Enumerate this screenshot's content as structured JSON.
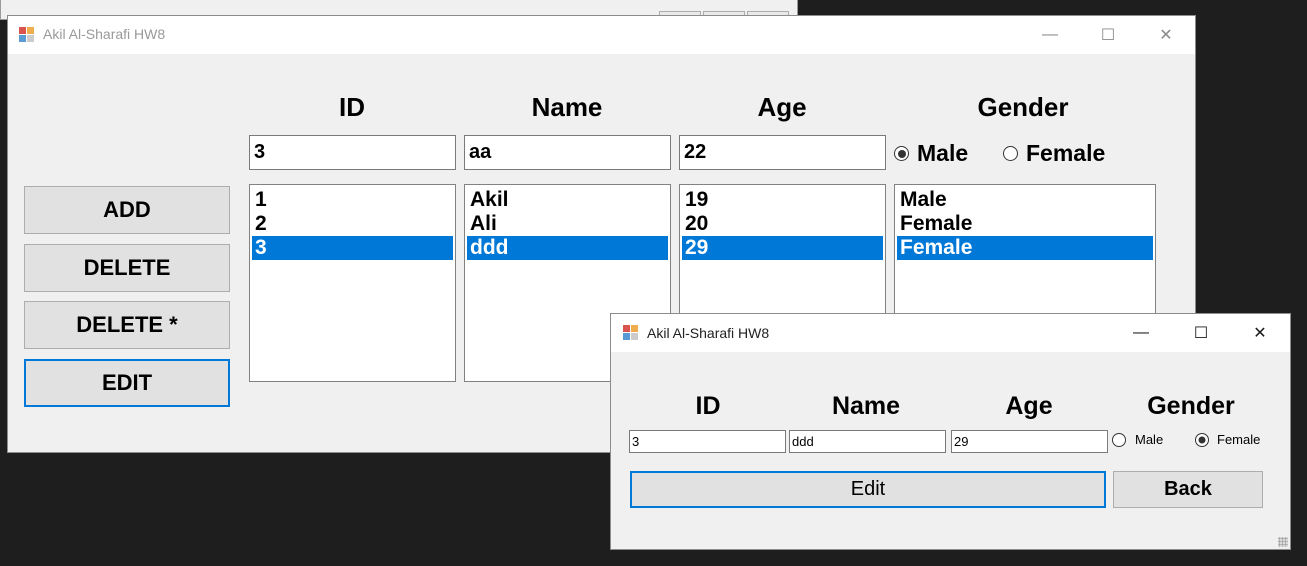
{
  "main_window": {
    "title": "Akil Al-Sharafi HW8",
    "headers": {
      "id": "ID",
      "name": "Name",
      "age": "Age",
      "gender": "Gender"
    },
    "inputs": {
      "id": "3",
      "name": "aa",
      "age": "22"
    },
    "gender_options": {
      "male": "Male",
      "female": "Female",
      "selected": "Male"
    },
    "buttons": {
      "add": "ADD",
      "delete": "DELETE",
      "delete_all": "DELETE *",
      "edit": "EDIT"
    },
    "list_ids": [
      "1",
      "2",
      "3"
    ],
    "list_names": [
      "Akil",
      "Ali",
      "ddd"
    ],
    "list_ages": [
      "19",
      "20",
      "29"
    ],
    "list_genders": [
      "Male",
      "Female",
      "Female"
    ],
    "selected_row": 2,
    "title_buttons": {
      "minimize": "—",
      "maximize": "☐",
      "close": "✕"
    }
  },
  "edit_window": {
    "title": "Akil Al-Sharafi HW8",
    "headers": {
      "id": "ID",
      "name": "Name",
      "age": "Age",
      "gender": "Gender"
    },
    "inputs": {
      "id": "3",
      "name": "ddd",
      "age": "29"
    },
    "gender_options": {
      "male": "Male",
      "female": "Female",
      "selected": "Female"
    },
    "buttons": {
      "edit": "Edit",
      "back": "Back"
    },
    "title_buttons": {
      "minimize": "—",
      "maximize": "☐",
      "close": "✕"
    }
  },
  "colors": {
    "selection": "#0078d7",
    "window_bg": "#f0f0f0",
    "desktop": "#1e1e1e"
  }
}
